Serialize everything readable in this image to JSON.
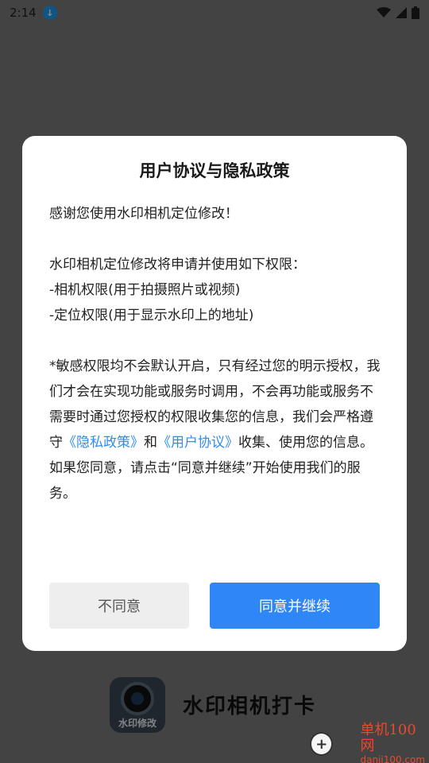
{
  "status_bar": {
    "time": "2:14",
    "download_icon": "download-icon",
    "wifi_icon": "wifi-icon",
    "signal_icon": "signal-icon",
    "battery_icon": "battery-icon"
  },
  "background_app": {
    "logo_text": "水印修改",
    "app_name": "水印相机打卡"
  },
  "dialog": {
    "title": "用户协议与隐私政策",
    "thanks": "感谢您使用水印相机定位修改！",
    "permissions_intro": "水印相机定位修改将申请并使用如下权限：",
    "permission_camera": "-相机权限(用于拍摄照片或视频)",
    "permission_location": "-定位权限(用于显示水印上的地址)",
    "notice_part1": "*敏感权限均不会默认开启，只有经过您的明示授权，我们才会在实现功能或服务时调用，不会再功能或服务不需要时通过您授权的权限收集您的信息，我们会严格遵守",
    "privacy_link": "《隐私政策》",
    "and_text": "和",
    "agreement_link": "《用户协议》",
    "notice_part2": "收集、使用您的信息。如果您同意，请点击“同意并继续”开始使用我们的服务。",
    "disagree_label": "不同意",
    "agree_label": "同意并继续"
  },
  "watermark": {
    "site_name": "单机100网",
    "site_url": "danji100.com"
  },
  "colors": {
    "accent": "#2f86f6",
    "link": "#2f8bf5",
    "watermark": "#e8492e"
  }
}
